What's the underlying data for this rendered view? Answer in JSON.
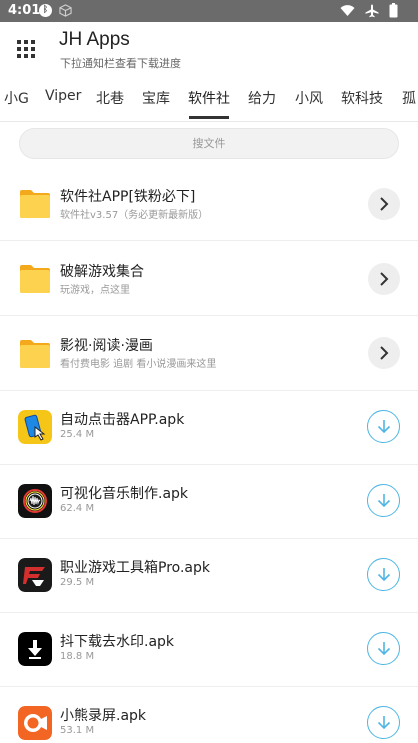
{
  "status_bar": {
    "time": "4:01",
    "left_icons": [
      "bluetooth-icon",
      "cube-icon"
    ],
    "right_icons": [
      "wifi-icon",
      "airplane-icon",
      "battery-icon"
    ]
  },
  "header": {
    "menu_icon": "grid-menu-icon",
    "title": "JH Apps",
    "subtitle": "下拉通知栏查看下载进度"
  },
  "tabs": {
    "items": [
      "小G",
      "Viper",
      "北巷",
      "宝库",
      "软件社",
      "给力",
      "小风",
      "软科技",
      "孤"
    ],
    "active_index": 4
  },
  "search": {
    "placeholder": "搜文件"
  },
  "folders": [
    {
      "title": "软件社APP[铁粉必下]",
      "subtitle": "软件社v3.57（务必更新最新版）",
      "icon": "folder-icon"
    },
    {
      "title": "破解游戏集合",
      "subtitle": "玩游戏，点这里",
      "icon": "folder-icon"
    },
    {
      "title": "影视·阅读·漫画",
      "subtitle": "看付费电影 追剧 看小说漫画来这里",
      "icon": "folder-icon"
    }
  ],
  "files": [
    {
      "title": "自动点击器APP.apk",
      "size": "25.4 M",
      "icon": "auto-clicker-app-icon",
      "color": "#f5c517"
    },
    {
      "title": "可视化音乐制作.apk",
      "size": "62.4 M",
      "icon": "music-visualizer-app-icon",
      "color": "#111111"
    },
    {
      "title": "职业游戏工具箱Pro.apk",
      "size": "29.5 M",
      "icon": "game-toolbox-app-icon",
      "color": "#1a1a1a"
    },
    {
      "title": "抖下载去水印.apk",
      "size": "18.8 M",
      "icon": "download-app-icon",
      "color": "#000000"
    },
    {
      "title": "小熊录屏.apk",
      "size": "53.1 M",
      "icon": "screen-recorder-app-icon",
      "color": "#f26522"
    }
  ],
  "colors": {
    "status_bar": "#6b6b6b",
    "folder": "#fcc831",
    "download_accent": "#4fb6e3"
  }
}
